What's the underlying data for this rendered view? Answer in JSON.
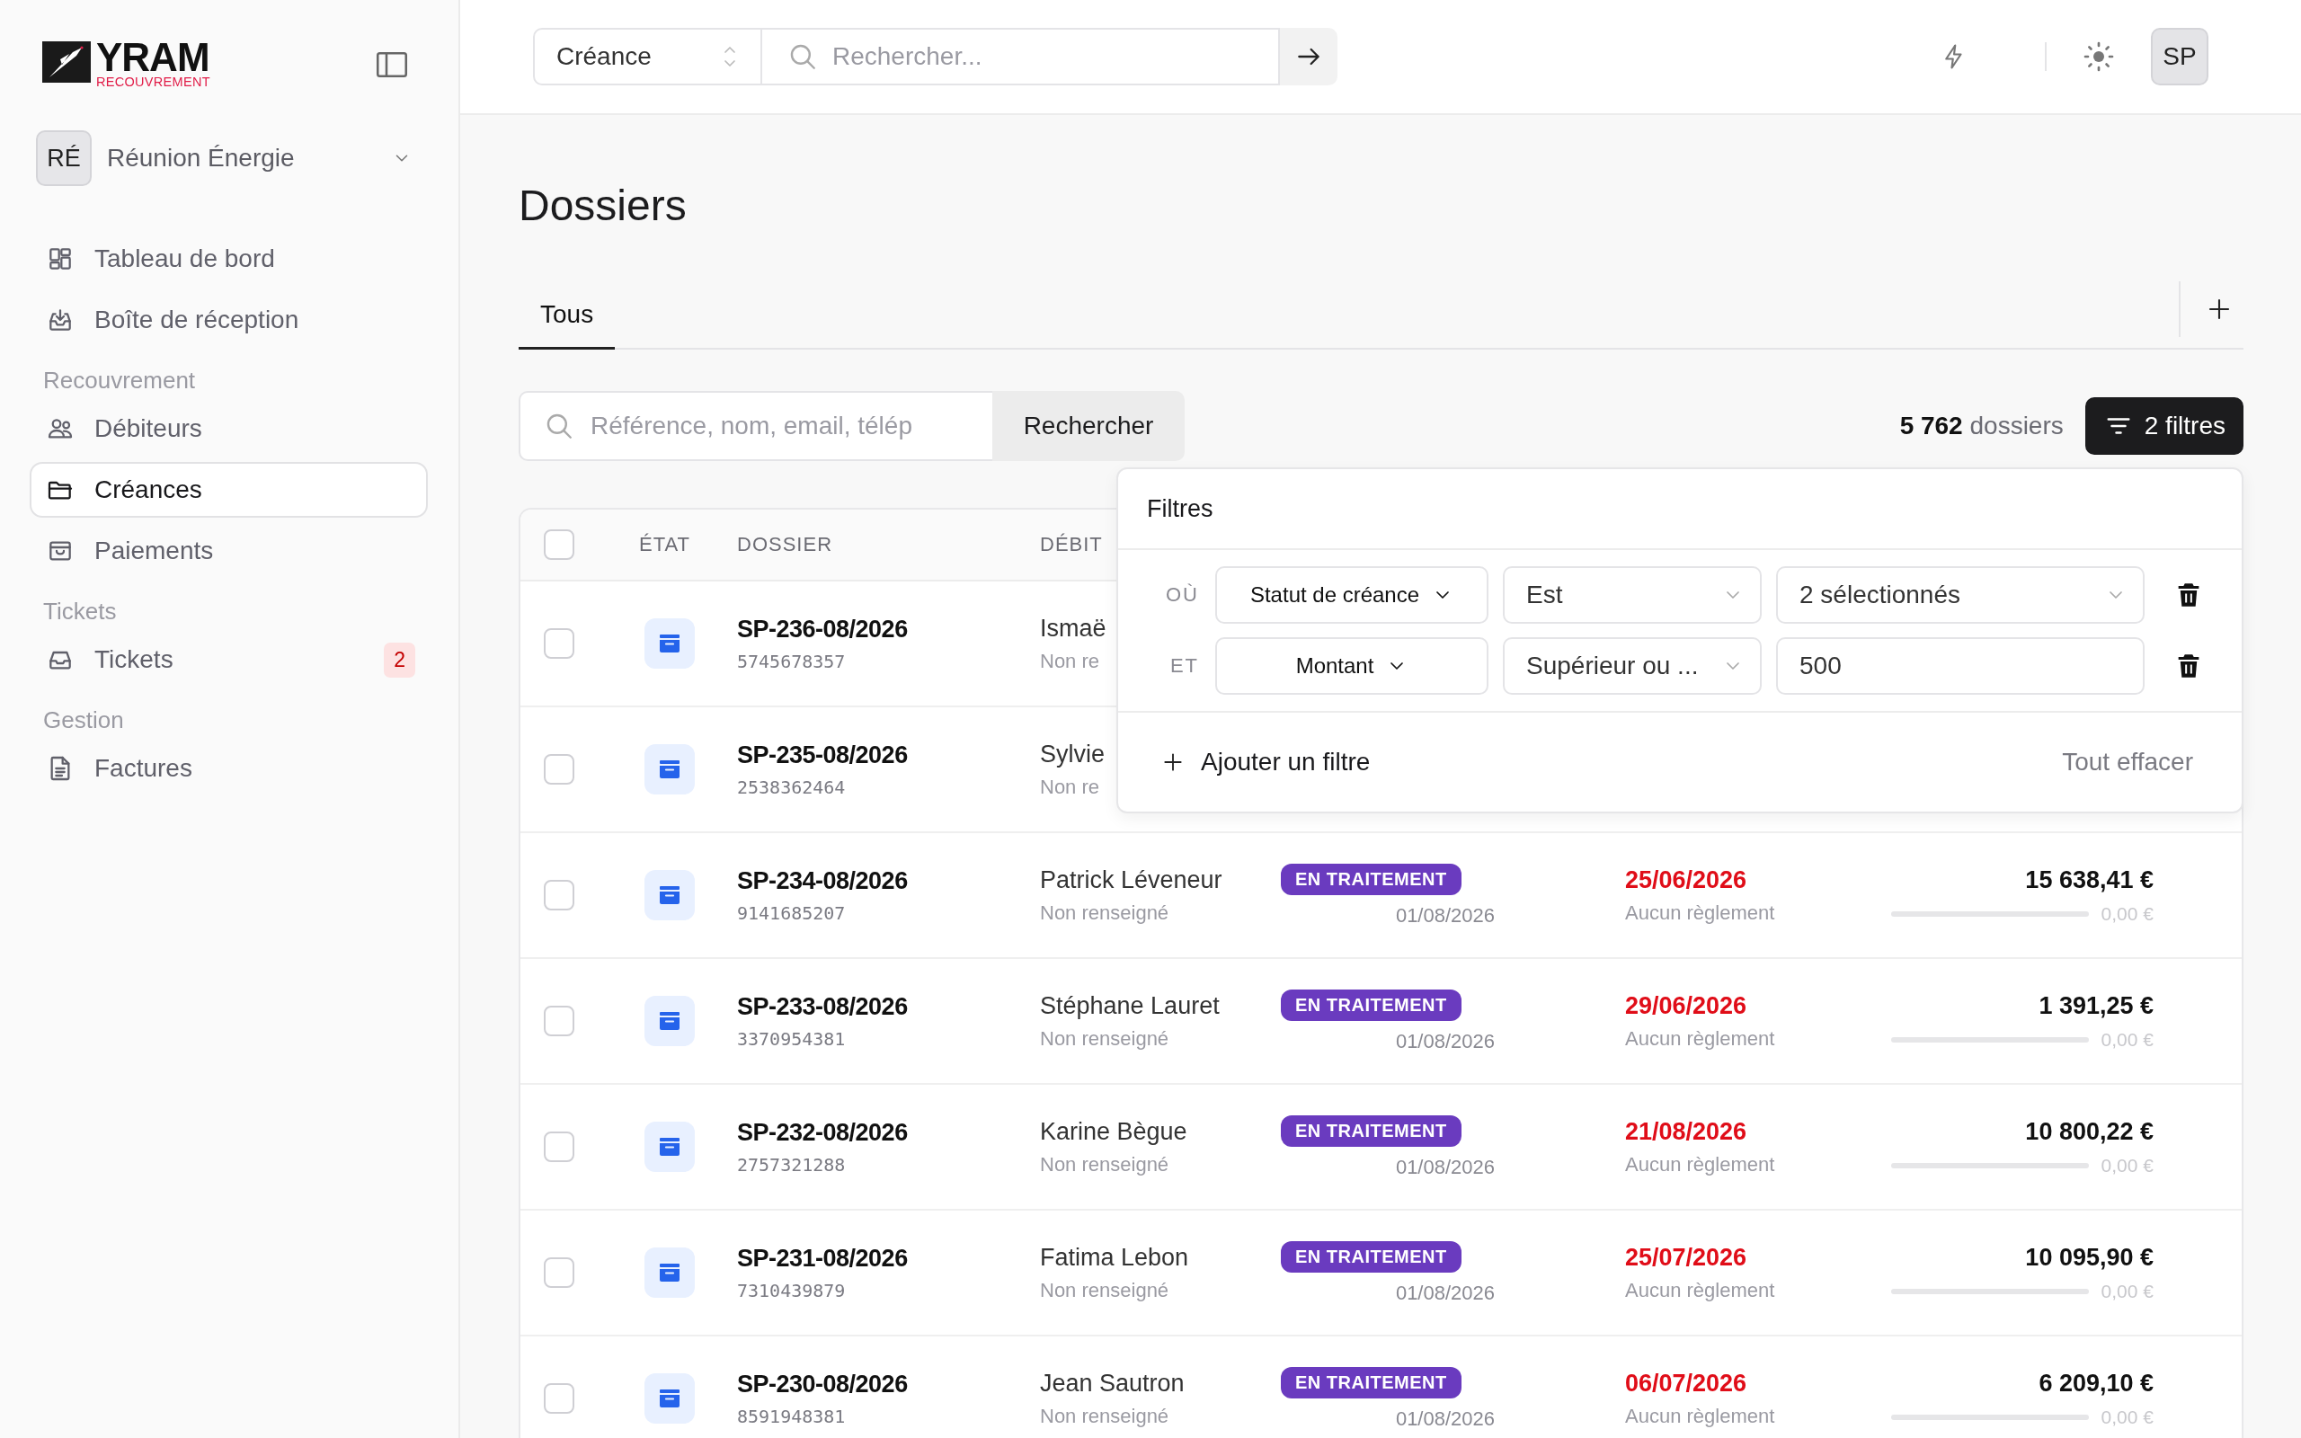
{
  "logo": {
    "name": "YRAM",
    "tagline": "RECOUVREMENT"
  },
  "org": {
    "initials": "RÉ",
    "name": "Réunion Énergie"
  },
  "nav": [
    {
      "kind": "item",
      "label": "Tableau de bord",
      "selected": false
    },
    {
      "kind": "item",
      "label": "Boîte de réception",
      "selected": false
    },
    {
      "kind": "section",
      "label": "Recouvrement"
    },
    {
      "kind": "item",
      "label": "Débiteurs",
      "selected": false
    },
    {
      "kind": "item",
      "label": "Créances",
      "selected": true
    },
    {
      "kind": "item",
      "label": "Paiements",
      "selected": false
    },
    {
      "kind": "section",
      "label": "Tickets"
    },
    {
      "kind": "item",
      "label": "Tickets",
      "selected": false,
      "badge": "2"
    },
    {
      "kind": "section",
      "label": "Gestion"
    },
    {
      "kind": "item",
      "label": "Factures",
      "selected": false
    }
  ],
  "topbar": {
    "scope": "Créance",
    "search_placeholder": "Rechercher...",
    "avatar": "SP"
  },
  "page": {
    "title": "Dossiers",
    "tabs": [
      {
        "label": "Tous",
        "selected": true
      }
    ]
  },
  "toolbar": {
    "search_placeholder": "Référence, nom, email, télép",
    "search_button": "Rechercher",
    "count": "**5 762** dossiers",
    "filter_button": "2 filtres"
  },
  "table": {
    "all_selected": false,
    "columns": [
      "ÉTAT",
      "DOSSIER",
      "DÉBIT"
    ],
    "rows": [
      {
        "selected": false,
        "dossier": "SP-236-08/2026",
        "ref": "5745678357",
        "debtor": "Ismaë",
        "debtor_sub": "Non re"
      },
      {
        "selected": false,
        "dossier": "SP-235-08/2026",
        "ref": "2538362464",
        "debtor": "Sylvie",
        "debtor_sub": "Non re"
      },
      {
        "selected": false,
        "dossier": "SP-234-08/2026",
        "ref": "9141685207",
        "debtor": "Patrick Léveneur",
        "debtor_sub": "Non renseigné",
        "status": "EN TRAITEMENT",
        "created": "01/08/2026",
        "due": "25/06/2026",
        "payment": "Aucun règlement",
        "amount": "15 638,41 €",
        "paid": "0,00 €",
        "level": 0
      },
      {
        "selected": false,
        "dossier": "SP-233-08/2026",
        "ref": "3370954381",
        "debtor": "Stéphane Lauret",
        "debtor_sub": "Non renseigné",
        "status": "EN TRAITEMENT",
        "created": "01/08/2026",
        "due": "29/06/2026",
        "payment": "Aucun règlement",
        "amount": "1 391,25 €",
        "paid": "0,00 €",
        "level": 0
      },
      {
        "selected": false,
        "dossier": "SP-232-08/2026",
        "ref": "2757321288",
        "debtor": "Karine Bègue",
        "debtor_sub": "Non renseigné",
        "status": "EN TRAITEMENT",
        "created": "01/08/2026",
        "due": "21/08/2026",
        "payment": "Aucun règlement",
        "amount": "10 800,22 €",
        "paid": "0,00 €",
        "level": 0
      },
      {
        "selected": false,
        "dossier": "SP-231-08/2026",
        "ref": "7310439879",
        "debtor": "Fatima Lebon",
        "debtor_sub": "Non renseigné",
        "status": "EN TRAITEMENT",
        "created": "01/08/2026",
        "due": "25/07/2026",
        "payment": "Aucun règlement",
        "amount": "10 095,90 €",
        "paid": "0,00 €",
        "level": 0
      },
      {
        "selected": false,
        "dossier": "SP-230-08/2026",
        "ref": "8591948381",
        "debtor": "Jean Sautron",
        "debtor_sub": "Non renseigné",
        "status": "EN TRAITEMENT",
        "created": "01/08/2026",
        "due": "06/07/2026",
        "payment": "Aucun règlement",
        "amount": "6 209,10 €",
        "paid": "0,00 €",
        "level": 0
      }
    ]
  },
  "filters": {
    "title": "Filtres",
    "rows": [
      {
        "conj": "OÙ",
        "field": "Statut de créance",
        "operator": "Est",
        "value": "2 sélectionnés",
        "kind": "select"
      },
      {
        "conj": "ET",
        "field": "Montant",
        "operator": "Supérieur ou ...",
        "value": "500",
        "kind": "input"
      }
    ],
    "add": "Ajouter un filtre",
    "clear": "Tout effacer"
  }
}
